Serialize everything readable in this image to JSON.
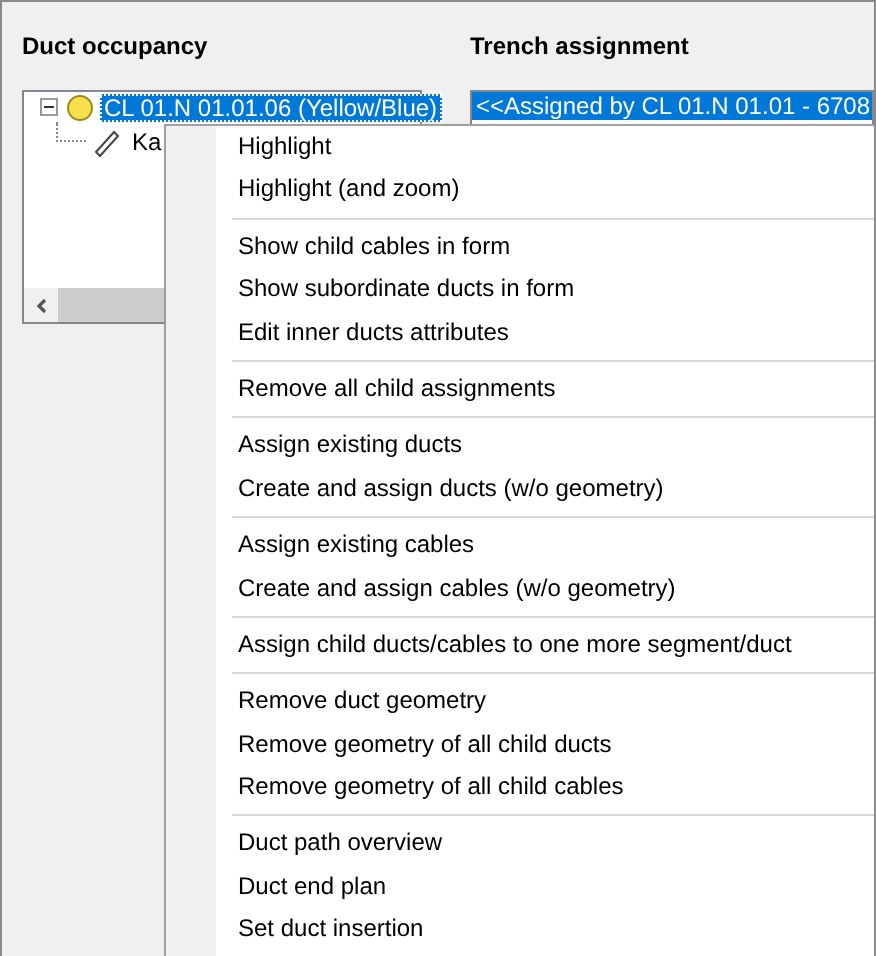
{
  "duct_occupancy": {
    "title": "Duct occupancy",
    "tree": [
      {
        "label": "CL 01.N 01.01.06 (Yellow/Blue)",
        "kind": "duct",
        "selected": true,
        "expanded": true,
        "children": [
          {
            "label": "Ka",
            "kind": "cable",
            "selected": false
          }
        ]
      }
    ]
  },
  "trench_assignment": {
    "title": "Trench assignment",
    "items": [
      {
        "label": "<<Assigned by CL 01.N 01.01 - 6708",
        "selected": true
      }
    ]
  },
  "context_menu": {
    "groups": [
      [
        {
          "label": "Highlight"
        },
        {
          "label": "Highlight (and zoom)"
        }
      ],
      [
        {
          "label": "Show child cables in form"
        },
        {
          "label": "Show subordinate ducts in form"
        },
        {
          "label": "Edit inner ducts attributes"
        }
      ],
      [
        {
          "label": "Remove all child assignments"
        }
      ],
      [
        {
          "label": "Assign existing ducts"
        },
        {
          "label": "Create and assign ducts (w/o geometry)"
        }
      ],
      [
        {
          "label": "Assign existing cables"
        },
        {
          "label": "Create and assign cables (w/o geometry)"
        }
      ],
      [
        {
          "label": "Assign child ducts/cables to one more segment/duct"
        }
      ],
      [
        {
          "label": "Remove duct geometry"
        },
        {
          "label": "Remove geometry of all child ducts"
        },
        {
          "label": "Remove geometry of all child cables"
        }
      ],
      [
        {
          "label": "Duct path overview"
        },
        {
          "label": "Duct end plan"
        },
        {
          "label": "Set duct insertion"
        }
      ]
    ]
  }
}
